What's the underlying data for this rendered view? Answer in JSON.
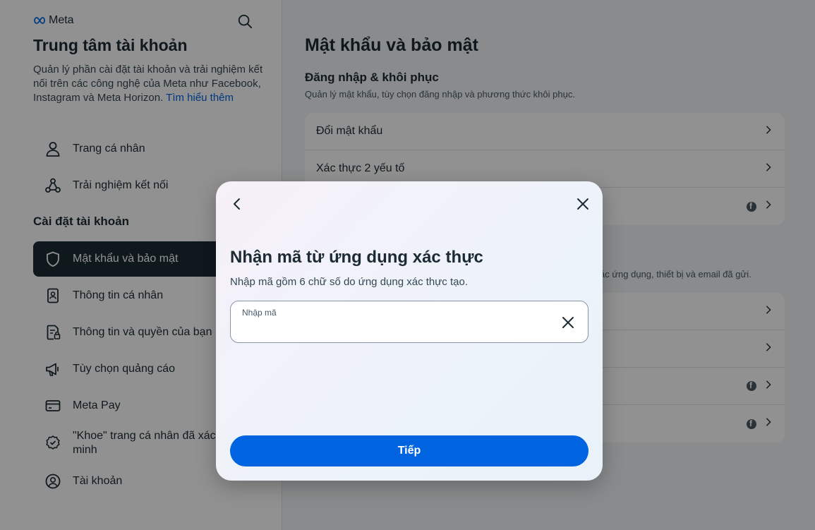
{
  "brand": {
    "logo_text": "Meta"
  },
  "sidebar": {
    "title": "Trung tâm tài khoản",
    "description": "Quản lý phần cài đặt tài khoản và trải nghiệm kết nối trên các công nghệ của Meta như Facebook, Instagram và Meta Horizon.",
    "learn_more": "Tìm hiểu thêm",
    "items_top": [
      {
        "label": "Trang cá nhân",
        "icon": "person-icon"
      },
      {
        "label": "Trải nghiệm kết nối",
        "icon": "connected-nodes-icon"
      }
    ],
    "section_label": "Cài đặt tài khoản",
    "items": [
      {
        "label": "Mật khẩu và bảo mật",
        "icon": "shield-icon",
        "active": true
      },
      {
        "label": "Thông tin cá nhân",
        "icon": "id-card-icon"
      },
      {
        "label": "Thông tin và quyền của bạn",
        "icon": "document-lock-icon"
      },
      {
        "label": "Tùy chọn quảng cáo",
        "icon": "megaphone-icon"
      },
      {
        "label": "Meta Pay",
        "icon": "card-icon"
      },
      {
        "label": "\"Khoe\" trang cá nhân đã xác minh",
        "icon": "verified-badge-icon"
      },
      {
        "label": "Tài khoản",
        "icon": "account-circle-icon"
      }
    ]
  },
  "main": {
    "title": "Mật khẩu và bảo mật",
    "login_section": {
      "title": "Đăng nhập & khôi phục",
      "description": "Quản lý mật khẩu, tùy chọn đăng nhập và phương thức khôi phục.",
      "rows": [
        {
          "label": "Đổi mật khẩu"
        },
        {
          "label": "Xác thực 2 yếu tố"
        },
        {
          "label": ""
        }
      ]
    },
    "security_section": {
      "description": "ác ứng dụng, thiết bị và email đã gửi.",
      "rows": [
        {
          "label": ""
        },
        {
          "label": ""
        },
        {
          "label": ""
        },
        {
          "label": ""
        }
      ]
    }
  },
  "modal": {
    "title": "Nhận mã từ ứng dụng xác thực",
    "description": "Nhập mã gồm 6 chữ số do ứng dụng xác thực tạo.",
    "field_label": "Nhập mã",
    "field_value": "",
    "submit_label": "Tiếp"
  }
}
